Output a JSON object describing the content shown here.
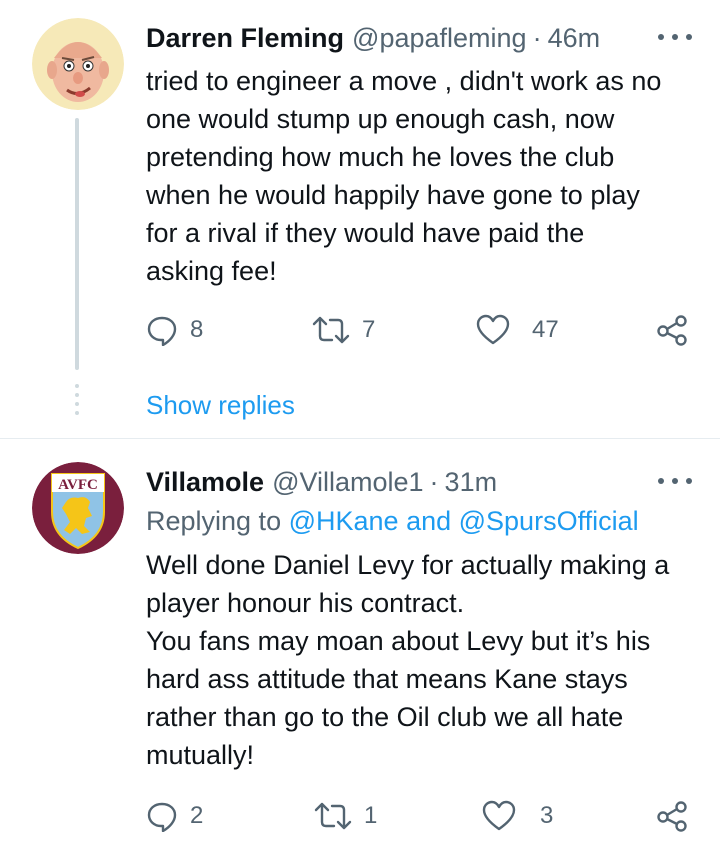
{
  "tweets": [
    {
      "name": "Darren Fleming",
      "handle": "@papafleming",
      "dot": "·",
      "time": "46m",
      "avatar_icon": "cartoon-face-avatar",
      "body": [
        "tried to engineer a move , didn't work as no",
        "one would stump up enough cash, now",
        "pretending how much he loves the club",
        "when he would happily have gone to play",
        "for a rival if they would have paid the",
        "asking fee!"
      ],
      "replies": "8",
      "retweets": "7",
      "likes": "47",
      "show_replies": "Show replies"
    },
    {
      "name": "Villamole",
      "handle": "@Villamole1",
      "dot": "·",
      "time": "31m",
      "avatar_text": "AVFC",
      "avatar_icon": "aston-villa-crest",
      "replying_prefix": "Replying to",
      "replying_mentions": "@HKane and @SpursOfficial",
      "body": [
        "Well done Daniel Levy for actually making a",
        "player honour his contract.",
        "You fans may moan about Levy but it’s his",
        "hard ass attitude that means Kane stays",
        "rather than go to the Oil club we all hate",
        "mutually!"
      ],
      "replies": "2",
      "retweets": "1",
      "likes": "3"
    }
  ],
  "colors": {
    "text": "#0f1419",
    "secondary": "#536471",
    "link": "#1d9bf0",
    "thread_line": "#cfd9de",
    "villa_claret": "#7a1f3d",
    "villa_gold": "#f5c518"
  }
}
